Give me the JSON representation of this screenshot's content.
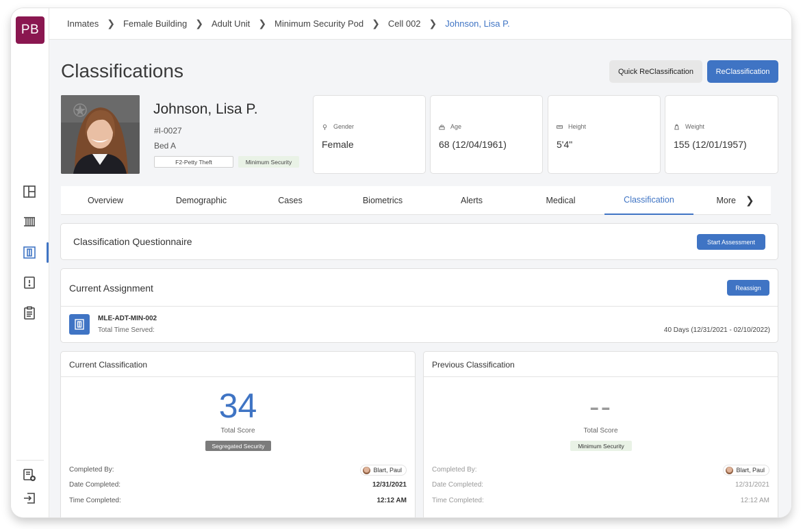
{
  "logo": "PB",
  "breadcrumb": [
    "Inmates",
    "Female Building",
    "Adult Unit",
    "Minimum Security Pod",
    "Cell 002",
    "Johnson, Lisa P."
  ],
  "page_title": "Classifications",
  "buttons": {
    "quick_reclass": "Quick ReClassification",
    "reclass": "ReClassification"
  },
  "inmate": {
    "name": "Johnson, Lisa P.",
    "id": "#I-0027",
    "bed": "Bed A",
    "charge_tag": "F2-Petty Theft",
    "security_tag": "Minimum Security"
  },
  "stats": [
    {
      "label": "Gender",
      "value": "Female",
      "icon": "location-pin-icon"
    },
    {
      "label": "Age",
      "value": "68  (12/04/1961)",
      "icon": "cake-icon"
    },
    {
      "label": "Height",
      "value": "5'4\"",
      "icon": "ruler-icon"
    },
    {
      "label": "Weight",
      "value": "155  (12/01/1957)",
      "icon": "weight-icon"
    }
  ],
  "tabs": [
    "Overview",
    "Demographic",
    "Cases",
    "Biometrics",
    "Alerts",
    "Medical",
    "Classification",
    "More"
  ],
  "active_tab": "Classification",
  "questionnaire": {
    "title": "Classification Questionnaire",
    "button": "Start Assessment"
  },
  "assignment": {
    "title": "Current Assignment",
    "button": "Reassign",
    "unit_code": "MLE-ADT-MIN-002",
    "served_label": "Total Time Served:",
    "served_value": "40 Days (12/31/2021 - 02/10/2022)"
  },
  "current_classification": {
    "title": "Current Classification",
    "score": "34",
    "score_label": "Total Score",
    "badge": "Segregated Security",
    "completed_by_label": "Completed By:",
    "completed_by": "Blart, Paul",
    "date_label": "Date Completed:",
    "date": "12/31/2021",
    "time_label": "Time Completed:",
    "time": "12:12 AM"
  },
  "previous_classification": {
    "title": "Previous Classification",
    "score": "--",
    "score_label": "Total Score",
    "badge": "Minimum Security",
    "completed_by_label": "Completed By:",
    "completed_by": "Blart, Paul",
    "date_label": "Date Completed:",
    "date": "12/31/2021",
    "time_label": "Time Completed:",
    "time": "12:12 AM"
  },
  "colors": {
    "brand": "#8a1750",
    "accent": "#3f74c4",
    "badge_dark": "#7b7b7b",
    "badge_green": "#e9f2e6"
  }
}
